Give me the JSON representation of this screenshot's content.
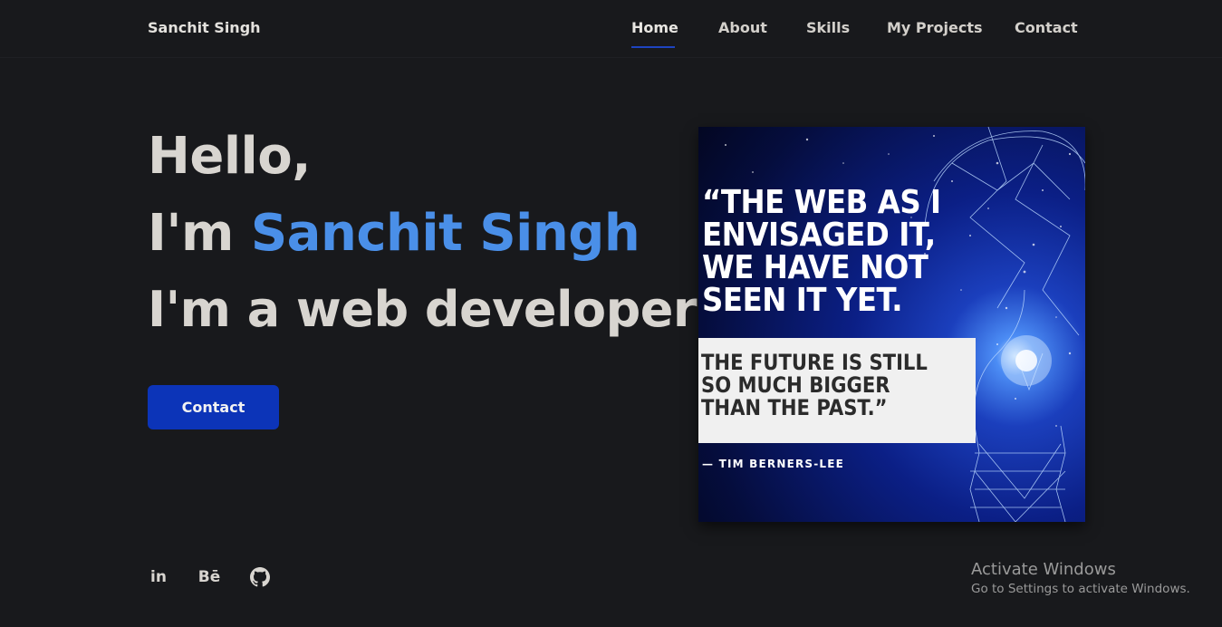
{
  "nav": {
    "brand": "Sanchit Singh",
    "links": [
      "Home",
      "About",
      "Skills",
      "My Projects",
      "Contact"
    ],
    "active": "Home"
  },
  "hero": {
    "greeting": "Hello,",
    "intro_prefix": "I'm ",
    "name": "Sanchit Singh",
    "role_line": "I'm a web developer",
    "button_label": "Contact"
  },
  "quote_image": {
    "main_lines": [
      "“THE WEB AS I",
      "ENVISAGED IT,",
      "WE HAVE NOT",
      "SEEN IT YET."
    ],
    "sub_lines": [
      "THE FUTURE IS STILL",
      "SO MUCH BIGGER",
      "THAN THE PAST.”"
    ],
    "author": "— TIM BERNERS-LEE"
  },
  "social": [
    {
      "icon": "linkedin-icon",
      "glyph": "in"
    },
    {
      "icon": "behance-icon",
      "glyph": "Bē"
    },
    {
      "icon": "github-icon"
    }
  ],
  "windows_watermark": {
    "title": "Activate Windows",
    "subtitle": "Go to Settings to activate Windows."
  },
  "colors": {
    "background": "#18191c",
    "accent_name": "#4a8fe8",
    "button": "#0c34b8",
    "nav_underline": "#1e44c0"
  }
}
